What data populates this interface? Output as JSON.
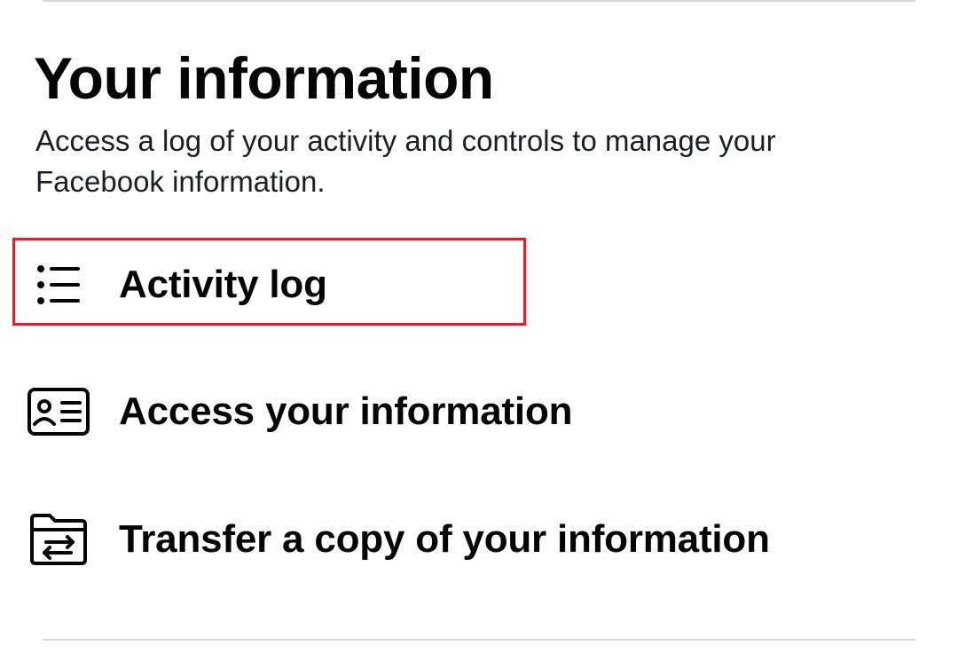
{
  "section": {
    "title": "Your information",
    "description": "Access a log of your activity and controls to manage your Facebook information."
  },
  "menu": {
    "items": [
      {
        "label": "Activity log",
        "icon": "list-icon",
        "highlighted": true
      },
      {
        "label": "Access your information",
        "icon": "id-card-icon",
        "highlighted": false
      },
      {
        "label": "Transfer a copy of your information",
        "icon": "folder-transfer-icon",
        "highlighted": false
      }
    ]
  },
  "colors": {
    "text": "#050505",
    "divider": "#d8d8d8",
    "highlight": "#d9242f"
  }
}
